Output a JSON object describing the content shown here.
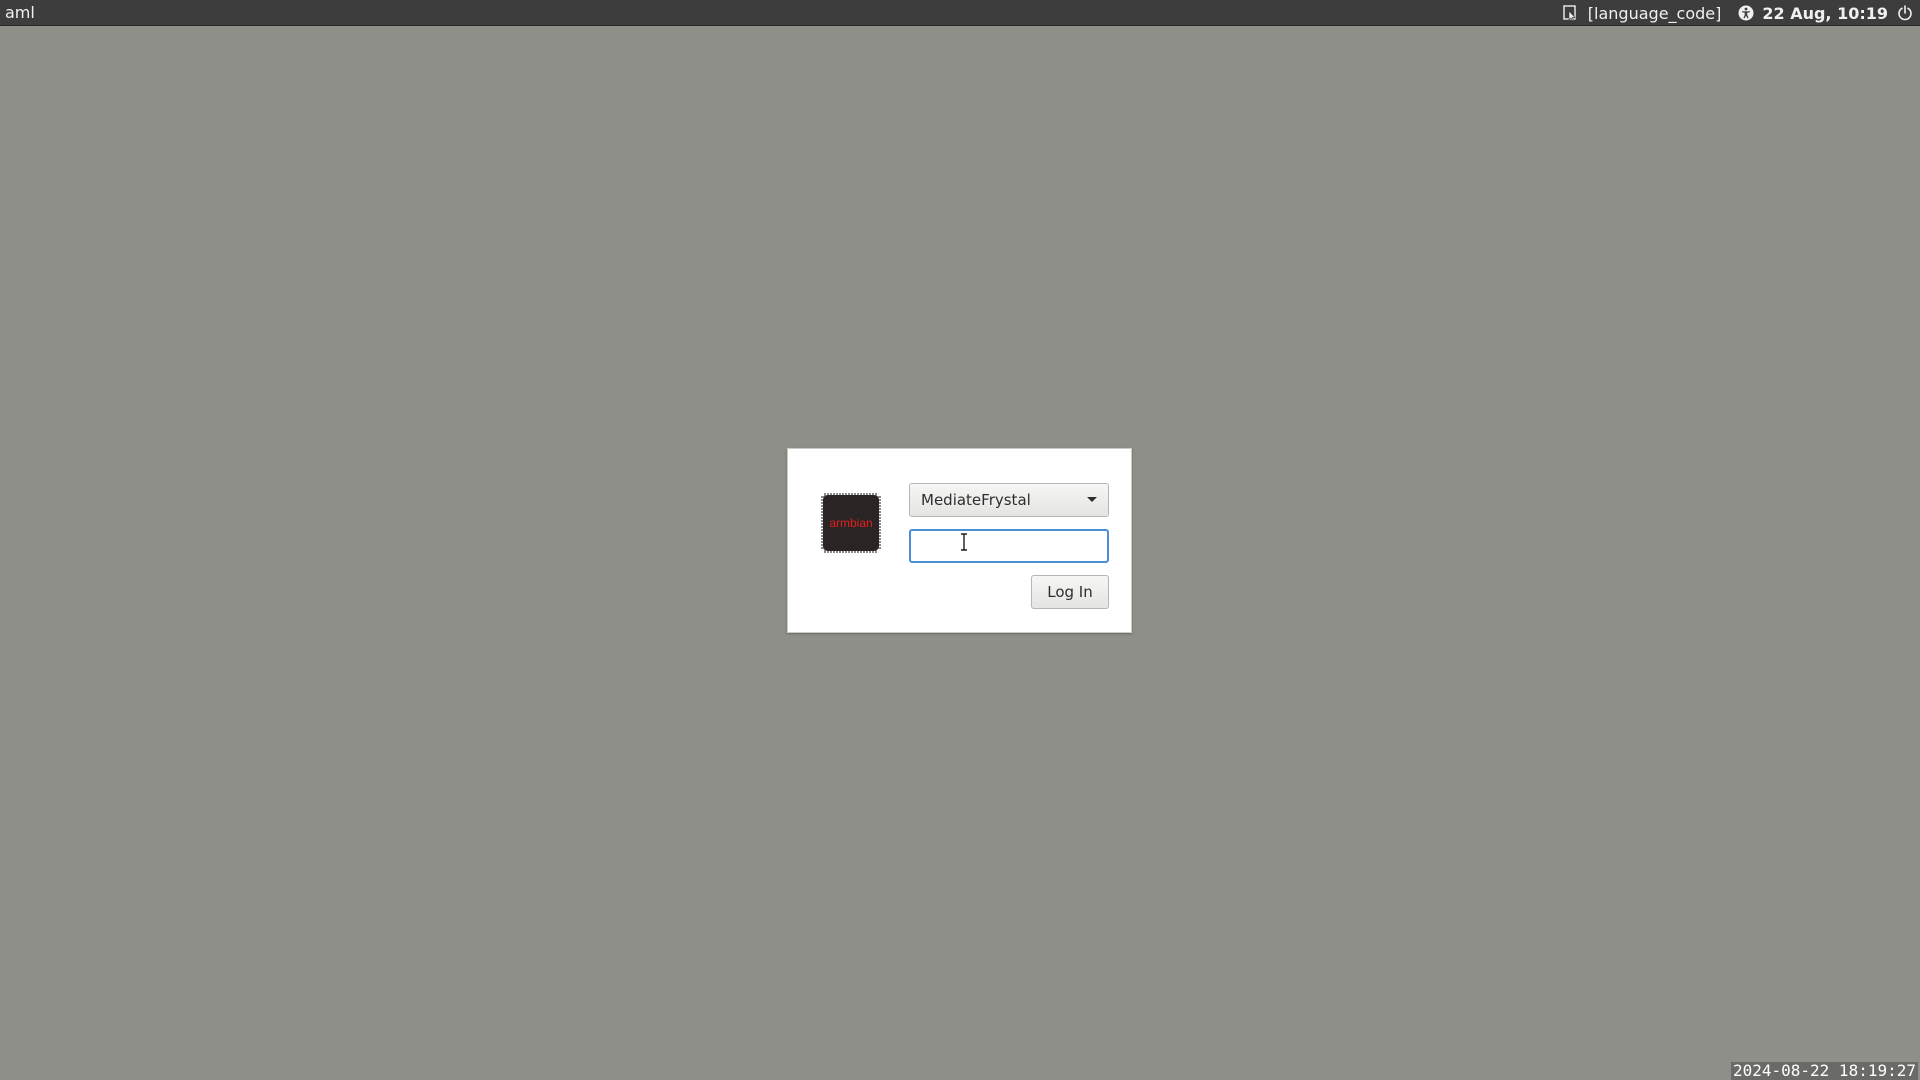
{
  "topbar": {
    "hostname": "aml",
    "language": "[language_code]",
    "clock": "22 Aug, 10:19",
    "icons": {
      "keyboard": "keyboard-layout-icon",
      "accessibility": "accessibility-icon",
      "power": "power-icon"
    }
  },
  "login": {
    "avatar_logo_text": "armbian",
    "selected_user": "MediateFrystal",
    "password_value": "",
    "login_button_label": "Log In"
  },
  "watermark": {
    "timestamp": "2024-08-22 18:19:27"
  },
  "colors": {
    "desktop": "#8e8f88",
    "topbar": "#3d3d3d",
    "focus": "#4a90d9",
    "logo_text": "#e0201f"
  }
}
